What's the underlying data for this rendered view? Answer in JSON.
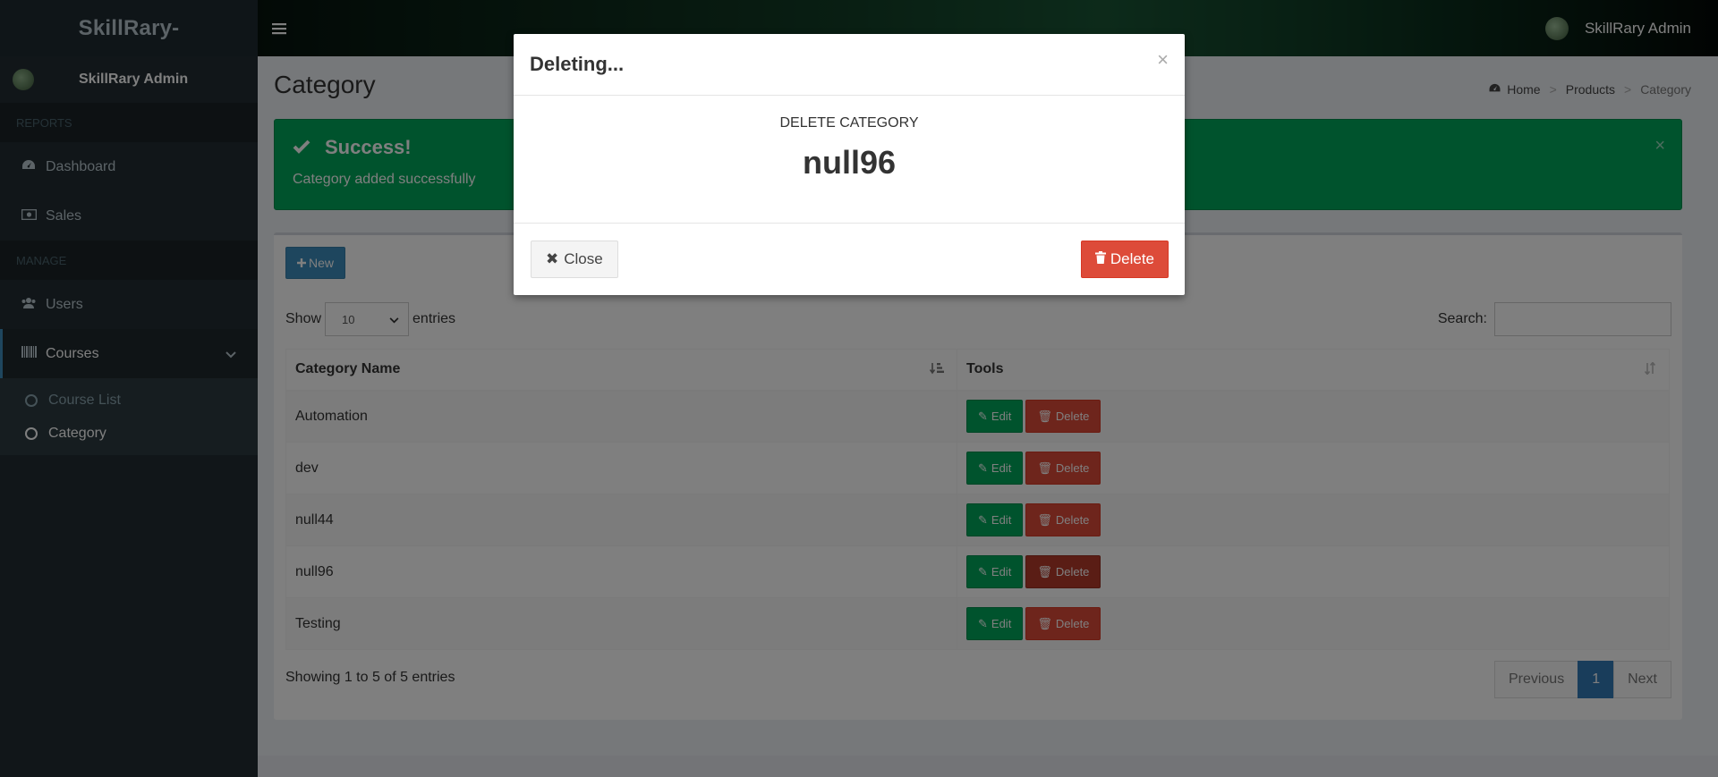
{
  "app": {
    "logo_text": "SkillRary-",
    "user_name": "SkillRary Admin"
  },
  "sidebar": {
    "section_reports": "REPORTS",
    "section_manage": "MANAGE",
    "items": [
      {
        "label": "Dashboard",
        "icon": "dashboard-icon"
      },
      {
        "label": "Sales",
        "icon": "money-icon"
      },
      {
        "label": "Users",
        "icon": "users-icon"
      },
      {
        "label": "Courses",
        "icon": "barcode-icon"
      }
    ],
    "submenu": [
      {
        "label": "Course List"
      },
      {
        "label": "Category"
      }
    ]
  },
  "topbar": {
    "user_name": "SkillRary Admin"
  },
  "page": {
    "title": "Category",
    "breadcrumb": [
      "Home",
      "Products",
      "Category"
    ]
  },
  "alert": {
    "title": "Success!",
    "message": "Category added successfully",
    "close": "×"
  },
  "toolbar": {
    "new_label": "New"
  },
  "table_controls": {
    "show_label": "Show",
    "entries_value": "10",
    "entries_label": "entries",
    "search_label": "Search:",
    "search_value": ""
  },
  "table": {
    "headers": [
      "Category Name",
      "Tools"
    ],
    "rows": [
      "Automation",
      "dev",
      "null44",
      "null96",
      "Testing"
    ],
    "edit_label": "Edit",
    "delete_label": "Delete"
  },
  "pagination": {
    "info": "Showing 1 to 5 of 5 entries",
    "previous": "Previous",
    "current": "1",
    "next": "Next"
  },
  "modal": {
    "title": "Deleting...",
    "close_symbol": "×",
    "label": "DELETE CATEGORY",
    "name": "null96",
    "close_button": "Close",
    "delete_button": "Delete"
  },
  "colors": {
    "success": "#00a65a",
    "danger": "#dd4b39",
    "primary": "#3c8dbc",
    "sidebar": "#222d32"
  }
}
